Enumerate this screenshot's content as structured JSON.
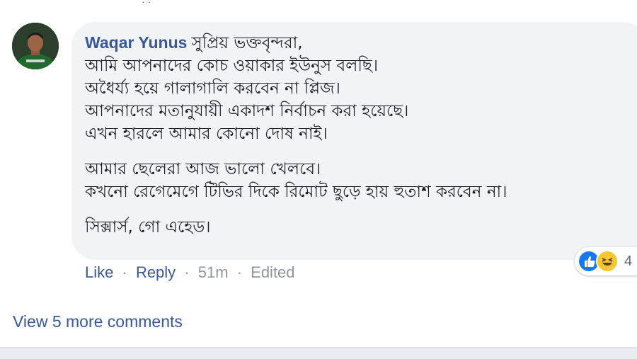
{
  "top_partial_text": "· ·",
  "comment": {
    "author": "Waqar Yunus",
    "lines": [
      "সুপ্রিয় ভক্তবৃন্দরা,",
      "আমি আপনাদের কোচ ওয়াকার ইউনুস বলছি।",
      "অধৈর্য্য হয়ে গালাগালি করবেন না প্লিজ।",
      "আপনাদের মতানুযায়ী একাদশ নির্বাচন করা হয়েছে।",
      "এখন হারলে আমার কোনো দোষ নাই।",
      "আমার ছেলেরা আজ ভালো খেলবে।",
      "কখনো রেগেমেগে টিভির দিকে রিমোট ছুড়ে হায় হুতাশ করবেন না।",
      "সিক্সার্স, গো এহেড।"
    ],
    "reactions": {
      "icons": [
        "like-reaction-icon",
        "haha-reaction-icon"
      ],
      "count": "4"
    },
    "actions": {
      "like": "Like",
      "reply": "Reply",
      "time": "51m",
      "edited": "Edited",
      "separator": "·"
    }
  },
  "view_more": "View 5 more comments",
  "colors": {
    "link": "#385898",
    "bubble": "#f2f3f5",
    "meta": "#90949c"
  }
}
